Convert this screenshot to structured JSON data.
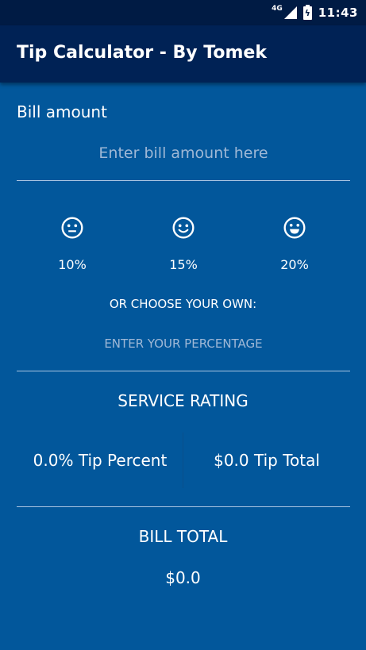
{
  "status_bar": {
    "network": "4G",
    "time": "11:43"
  },
  "app_bar": {
    "title": "Tip Calculator - By Tomek"
  },
  "bill": {
    "label": "Bill amount",
    "placeholder": "Enter bill amount here",
    "value": ""
  },
  "tip_options": [
    {
      "icon": "neutral-face-icon",
      "label": "10%"
    },
    {
      "icon": "smiling-face-icon",
      "label": "15%"
    },
    {
      "icon": "grinning-face-icon",
      "label": "20%"
    }
  ],
  "custom_tip": {
    "label": "OR CHOOSE YOUR OWN:",
    "placeholder": "ENTER YOUR PERCENTAGE",
    "value": ""
  },
  "service_rating": {
    "label": "SERVICE RATING"
  },
  "results": {
    "tip_percent": "0.0% Tip Percent",
    "tip_total": "$0.0 Tip Total"
  },
  "bill_total": {
    "label": "BILL TOTAL",
    "value": "$0.0"
  },
  "colors": {
    "background": "#02579b",
    "app_bar": "#002255",
    "status_bar": "#001b44",
    "divider": "#a8c4e2",
    "hint_text": "#9fb8d6"
  }
}
